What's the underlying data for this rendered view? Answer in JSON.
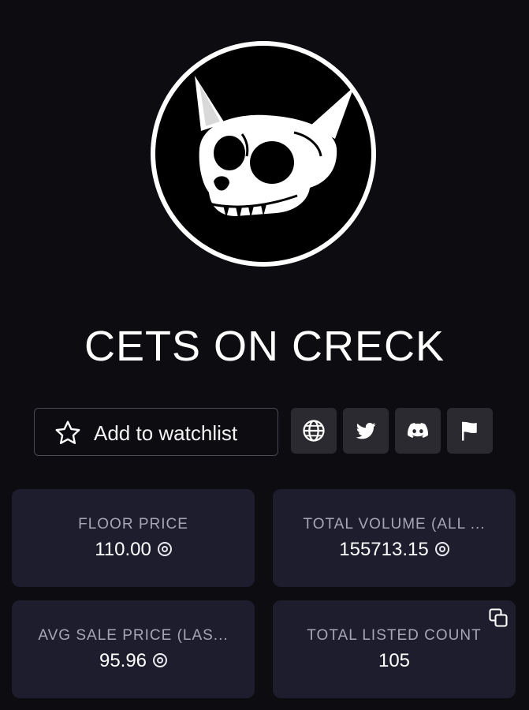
{
  "collection": {
    "title": "CETS ON CRECK"
  },
  "actions": {
    "watchlist_label": "Add to watchlist",
    "links": [
      {
        "icon": "globe-icon"
      },
      {
        "icon": "twitter-icon"
      },
      {
        "icon": "discord-icon"
      },
      {
        "icon": "flag-icon"
      }
    ]
  },
  "stats": {
    "floor_price": {
      "label": "FLOOR PRICE",
      "value": "110.00"
    },
    "total_volume": {
      "label": "TOTAL VOLUME (ALL ...",
      "value": "155713.15"
    },
    "avg_sale_price": {
      "label": "AVG SALE PRICE (LAS...",
      "value": "95.96"
    },
    "total_listed_count": {
      "label": "TOTAL LISTED COUNT",
      "value": "105"
    }
  },
  "colors": {
    "background": "#0c0c11",
    "card": "#1e1d2e",
    "icon_button": "#2a2a30",
    "label": "#a6a6b4"
  }
}
